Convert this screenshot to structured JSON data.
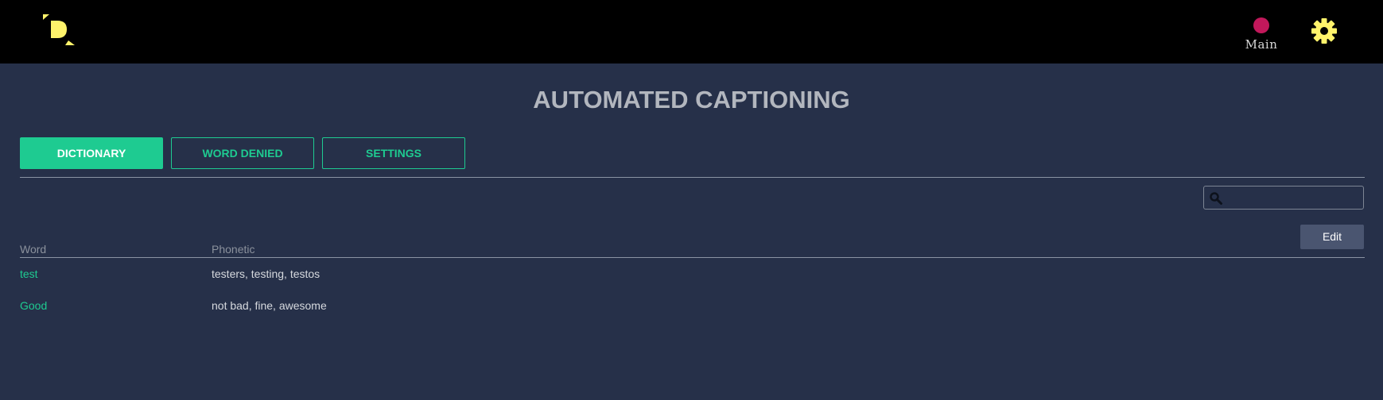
{
  "header": {
    "logo_icon": "d-logo-icon",
    "status_label": "Main",
    "status_color": "#c2185b",
    "settings_icon": "gear-icon",
    "accent_color": "#fff36b"
  },
  "page": {
    "title": "AUTOMATED CAPTIONING"
  },
  "tabs": [
    {
      "label": "DICTIONARY",
      "active": true
    },
    {
      "label": "WORD DENIED",
      "active": false
    },
    {
      "label": "SETTINGS",
      "active": false
    }
  ],
  "search": {
    "icon": "search-icon",
    "value": "",
    "placeholder": ""
  },
  "toolbar": {
    "edit_label": "Edit"
  },
  "table": {
    "columns": [
      "Word",
      "Phonetic"
    ],
    "rows": [
      {
        "word": "test",
        "phonetic": "testers, testing, testos"
      },
      {
        "word": "Good",
        "phonetic": "not bad, fine, awesome"
      }
    ]
  },
  "colors": {
    "background": "#263049",
    "topbar": "#000000",
    "brand_green": "#1ecb91",
    "title_gray": "#b2b6be"
  }
}
